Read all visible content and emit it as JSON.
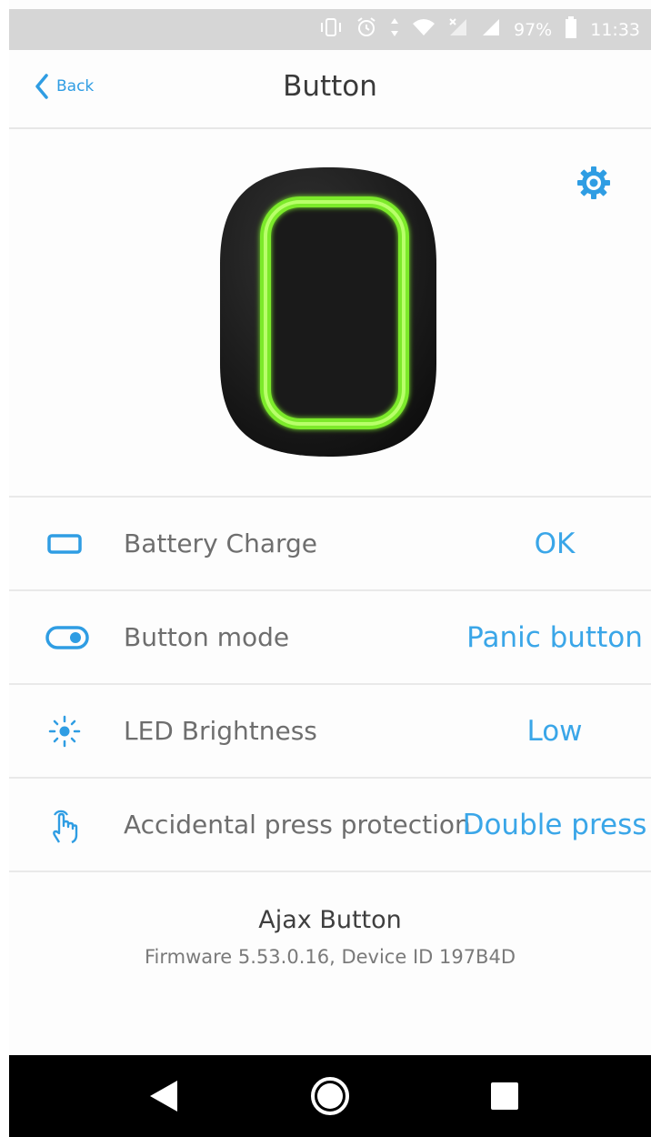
{
  "status_bar": {
    "battery_percent": "97%",
    "time": "11:33"
  },
  "header": {
    "back_label": "Back",
    "title": "Button"
  },
  "device": {
    "led_color": "#7bea2a",
    "body_color": "#1c1c1c"
  },
  "settings": [
    {
      "icon": "battery-icon",
      "label": "Battery Charge",
      "value": "OK"
    },
    {
      "icon": "toggle-icon",
      "label": "Button mode",
      "value": "Panic button"
    },
    {
      "icon": "brightness-icon",
      "label": "LED Brightness",
      "value": "Low"
    },
    {
      "icon": "hand-touch-icon",
      "label": "Accidental press protection",
      "value": "Double press"
    }
  ],
  "footer": {
    "device_name": "Ajax Button",
    "firmware_line": "Firmware 5.53.0.16, Device ID 197B4D"
  },
  "colors": {
    "accent": "#2f9de3",
    "value_text": "#3aa6e8"
  }
}
